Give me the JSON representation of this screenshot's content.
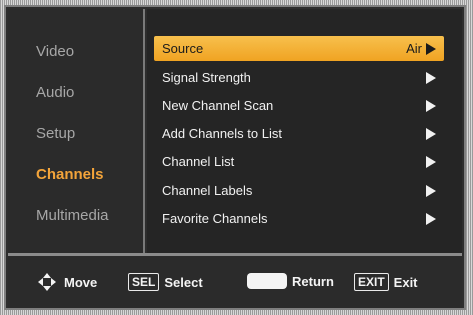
{
  "left_menu": {
    "items": [
      {
        "label": "Video"
      },
      {
        "label": "Audio"
      },
      {
        "label": "Setup"
      },
      {
        "label": "Channels"
      },
      {
        "label": "Multimedia"
      }
    ],
    "active_index": 3
  },
  "right_menu": {
    "items": [
      {
        "label": "Source",
        "value": "Air",
        "icon": "arrow-right-icon"
      },
      {
        "label": "Signal Strength",
        "value": "",
        "icon": "arrow-right-icon"
      },
      {
        "label": "New Channel Scan",
        "value": "",
        "icon": "arrow-right-icon"
      },
      {
        "label": "Add Channels to List",
        "value": "",
        "icon": "arrow-right-icon"
      },
      {
        "label": "Channel List",
        "value": "",
        "icon": "arrow-right-icon"
      },
      {
        "label": "Channel Labels",
        "value": "",
        "icon": "arrow-right-icon"
      },
      {
        "label": "Favorite Channels",
        "value": "",
        "icon": "arrow-right-icon"
      }
    ],
    "selected_index": 0
  },
  "bottom_bar": {
    "move_label": "Move",
    "sel_key": "SEL",
    "select_label": "Select",
    "return_label": "Return",
    "exit_key": "EXIT",
    "exit_label": "Exit"
  },
  "colors": {
    "accent": "#f0a322",
    "active_text": "#f3a43a",
    "panel_bg": "#2b2b2b"
  }
}
